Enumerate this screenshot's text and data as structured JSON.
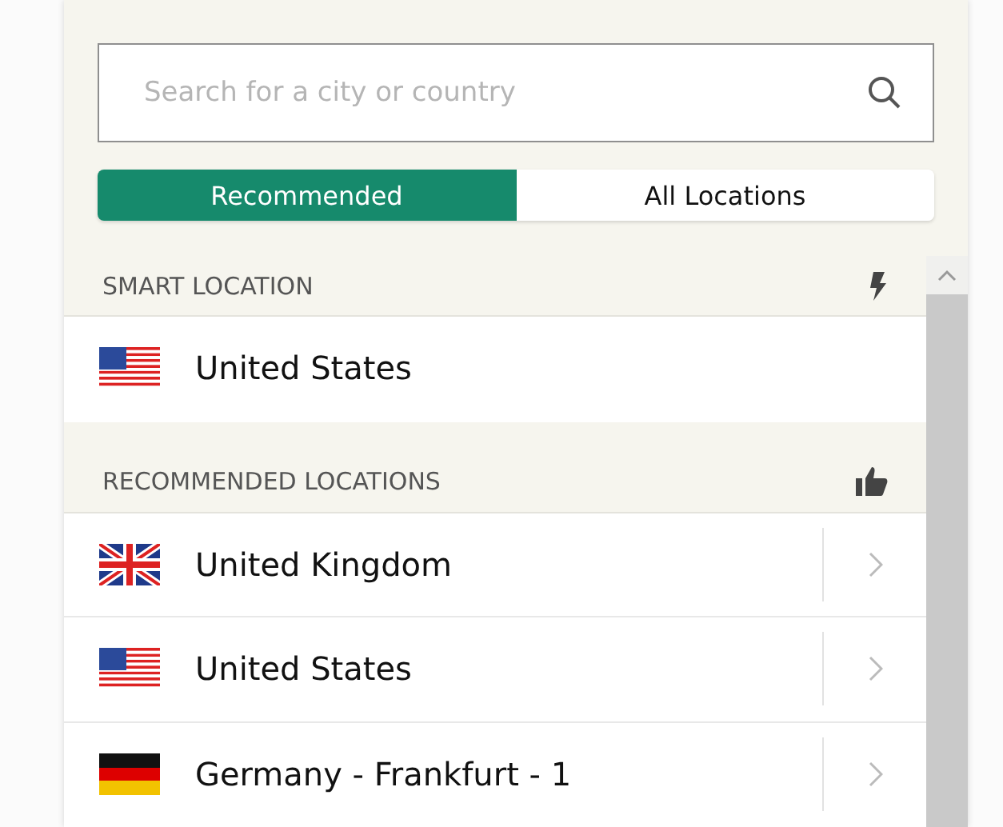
{
  "search": {
    "placeholder": "Search for a city or country"
  },
  "tabs": [
    {
      "label": "Recommended",
      "selected": true
    },
    {
      "label": "All Locations",
      "selected": false
    }
  ],
  "sections": [
    {
      "title": "SMART LOCATION",
      "items": [
        {
          "kind": "us",
          "name": "United States",
          "chevron": false
        }
      ]
    },
    {
      "title": "RECOMMENDED LOCATIONS",
      "items": [
        {
          "kind": "uk",
          "name": "United Kingdom",
          "chevron": true
        },
        {
          "kind": "us",
          "name": "United States",
          "chevron": true
        },
        {
          "kind": "de",
          "name": "Germany - Frankfurt - 1",
          "chevron": true
        }
      ]
    }
  ]
}
